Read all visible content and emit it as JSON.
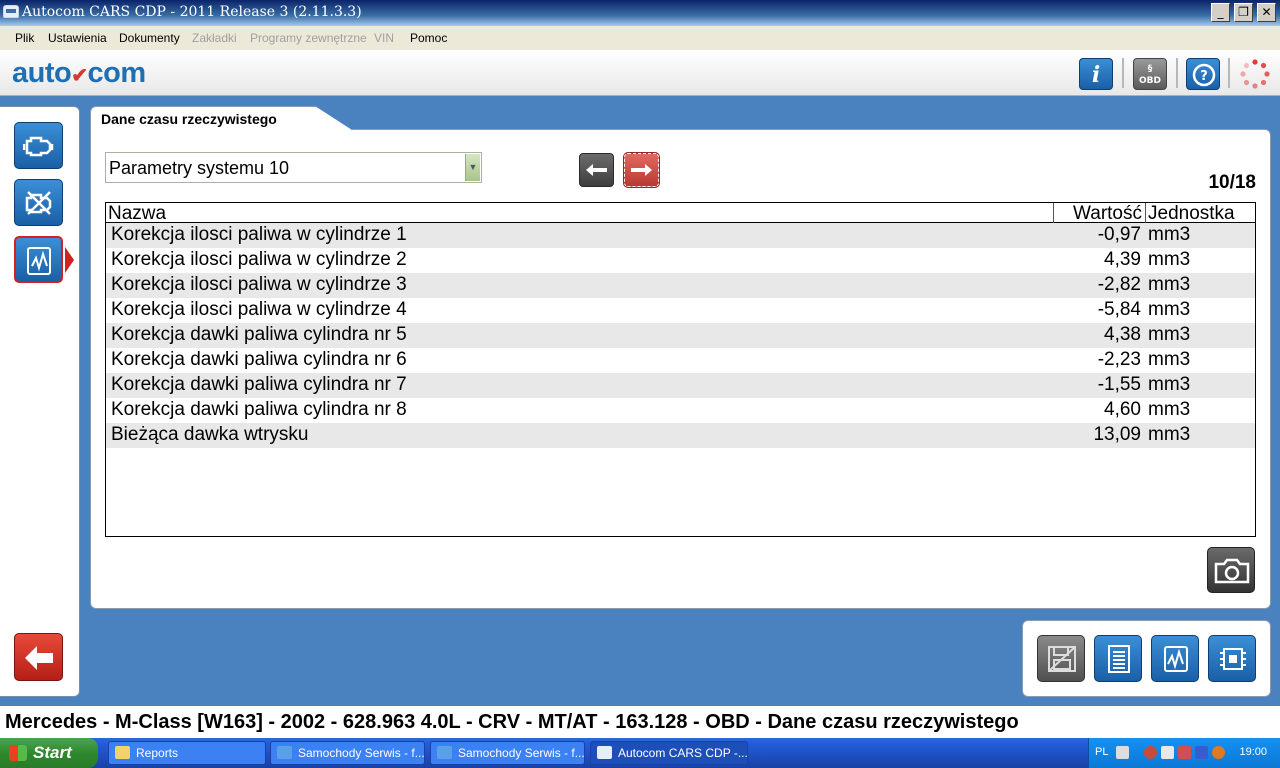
{
  "window": {
    "title": "Autocom CARS CDP - 2011 Release 3 (2.11.3.3)",
    "minimize": "_",
    "maximize": "❐",
    "close": "✕"
  },
  "menu": [
    {
      "label": "Plik",
      "enabled": true
    },
    {
      "label": "Ustawienia",
      "enabled": true
    },
    {
      "label": "Dokumenty",
      "enabled": true
    },
    {
      "label": "Zakładki",
      "enabled": false
    },
    {
      "label": "Programy zewnętrzne",
      "enabled": false
    },
    {
      "label": "VIN",
      "enabled": false
    },
    {
      "label": "Pomoc",
      "enabled": true
    }
  ],
  "brand": {
    "part1": "auto",
    "part2": "com",
    "accent_color": "#1f6fb4",
    "accent_red": "#d63b2f"
  },
  "toolbar": {
    "info_label": "i",
    "obd_label": "OBD",
    "obd_top": "§"
  },
  "tab": {
    "label": "Dane czasu rzeczywistego"
  },
  "selector": {
    "value": "Parametry systemu 10"
  },
  "pager": {
    "text": "10/18"
  },
  "table": {
    "headers": {
      "name": "Nazwa",
      "value": "Wartość",
      "unit": "Jednostka"
    },
    "rows": [
      {
        "name": "Korekcja ilosci paliwa w cylindrze 1",
        "value": "-0,97",
        "unit": "mm3"
      },
      {
        "name": "Korekcja ilosci paliwa w cylindrze 2",
        "value": "4,39",
        "unit": "mm3"
      },
      {
        "name": "Korekcja ilosci paliwa w cylindrze 3",
        "value": "-2,82",
        "unit": "mm3"
      },
      {
        "name": "Korekcja ilosci paliwa w cylindrze 4",
        "value": "-5,84",
        "unit": "mm3"
      },
      {
        "name": "Korekcja dawki paliwa cylindra nr 5",
        "value": "4,38",
        "unit": "mm3"
      },
      {
        "name": "Korekcja dawki paliwa cylindra nr 6",
        "value": "-2,23",
        "unit": "mm3"
      },
      {
        "name": "Korekcja dawki paliwa cylindra nr 7",
        "value": "-1,55",
        "unit": "mm3"
      },
      {
        "name": "Korekcja dawki paliwa cylindra nr 8",
        "value": "4,60",
        "unit": "mm3"
      },
      {
        "name": "Bieżąca dawka wtrysku",
        "value": "13,09",
        "unit": "mm3"
      }
    ]
  },
  "status": {
    "text": "Mercedes - M-Class [W163] - 2002 - 628.963 4.0L - CRV - MT/AT - 163.128 - OBD - Dane czasu rzeczywistego"
  },
  "taskbar": {
    "start": "Start",
    "tasks": [
      {
        "label": "Reports",
        "icon": "folder-icon"
      },
      {
        "label": "Samochody Serwis - f...",
        "icon": "ie-icon"
      },
      {
        "label": "Samochody Serwis - f...",
        "icon": "ie-icon"
      },
      {
        "label": "Autocom CARS CDP -...",
        "icon": "autocom-icon"
      }
    ],
    "lang": "PL",
    "clock": "19:00"
  }
}
